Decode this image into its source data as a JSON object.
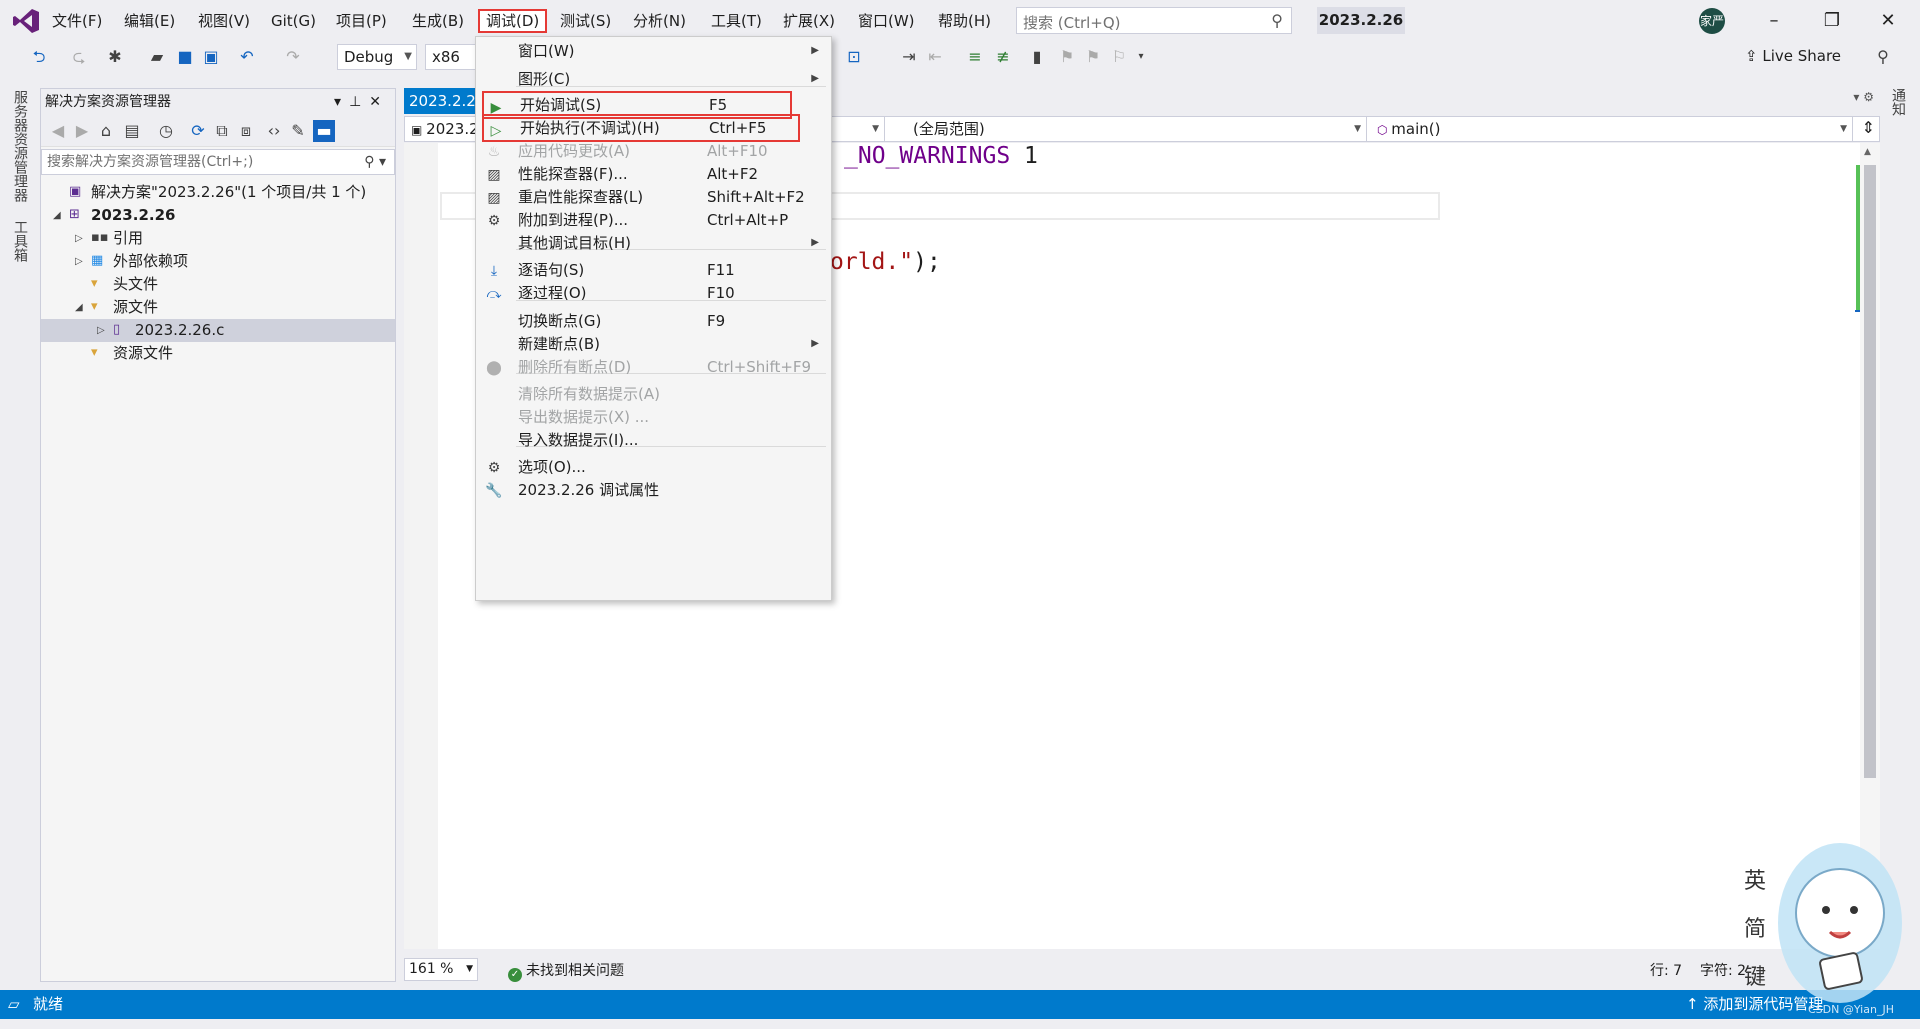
{
  "menubar": {
    "items": [
      "文件(F)",
      "编辑(E)",
      "视图(V)",
      "Git(G)",
      "项目(P)",
      "生成(B)",
      "调试(D)",
      "测试(S)",
      "分析(N)",
      "工具(T)",
      "扩展(X)",
      "窗口(W)",
      "帮助(H)"
    ],
    "active": "调试(D)"
  },
  "search": {
    "placeholder": "搜索 (Ctrl+Q)"
  },
  "solution_name": "2023.2.26",
  "account_initials": "家严",
  "window_controls": {
    "minimize": "–",
    "restore": "❐",
    "close": "✕"
  },
  "toolbar": {
    "config": "Debug",
    "platform": "x86",
    "live_share": "Live Share"
  },
  "left_tabs": [
    "服务器资源管理器",
    "工具箱"
  ],
  "right_tabs": [
    "通知"
  ],
  "solution_explorer": {
    "title": "解决方案资源管理器",
    "search_placeholder": "搜索解决方案资源管理器(Ctrl+;)",
    "tree": [
      {
        "label": "解决方案\"2023.2.26\"(1 个项目/共 1 个)",
        "level": 0,
        "expander": "",
        "icon": "solution-icon",
        "bold": false
      },
      {
        "label": "2023.2.26",
        "level": 0,
        "expander": "◢",
        "icon": "project-icon",
        "bold": true
      },
      {
        "label": "引用",
        "level": 1,
        "expander": "▷",
        "icon": "references-icon",
        "bold": false
      },
      {
        "label": "外部依赖项",
        "level": 1,
        "expander": "▷",
        "icon": "external-deps-icon",
        "bold": false
      },
      {
        "label": "头文件",
        "level": 1,
        "expander": "",
        "icon": "filter-icon",
        "bold": false
      },
      {
        "label": "源文件",
        "level": 1,
        "expander": "◢",
        "icon": "filter-icon",
        "bold": false
      },
      {
        "label": "2023.2.26.c",
        "level": 2,
        "expander": "▷",
        "icon": "c-file-icon",
        "bold": false
      },
      {
        "label": "资源文件",
        "level": 1,
        "expander": "",
        "icon": "filter-icon",
        "bold": false
      }
    ],
    "selected": "2023.2.26.c"
  },
  "editor": {
    "tab_label": "2023.2.26",
    "nav_file": "2023.2",
    "nav_scope": "(全局范围)",
    "nav_member": "main()",
    "code_visible": [
      {
        "text": "_NO_WARNINGS",
        "color": "#6f008a"
      },
      {
        "text": " 1",
        "color": "#1e1e1e"
      },
      {
        "text": "orld.\"",
        "color": "#a31515"
      },
      {
        "text": ");",
        "color": "#1e1e1e"
      }
    ],
    "zoom": "161 %",
    "issues": "未找到相关问题",
    "line": "行: 7",
    "col": "字符: 2"
  },
  "debug_menu": {
    "items": [
      {
        "label": "窗口(W)",
        "shortcut": "",
        "icon": "",
        "submenu": true,
        "disabled": false,
        "highlighted": false
      },
      {
        "label": "图形(C)",
        "shortcut": "",
        "icon": "",
        "submenu": true,
        "disabled": false,
        "highlighted": false
      },
      {
        "label": "开始调试(S)",
        "shortcut": "F5",
        "icon": "play-icon",
        "submenu": false,
        "disabled": false,
        "highlighted": true
      },
      {
        "label": "开始执行(不调试)(H)",
        "shortcut": "Ctrl+F5",
        "icon": "play-outline-icon",
        "submenu": false,
        "disabled": false,
        "highlighted": true
      },
      {
        "label": "应用代码更改(A)",
        "shortcut": "Alt+F10",
        "icon": "flame-icon",
        "submenu": false,
        "disabled": true,
        "highlighted": false
      },
      {
        "label": "性能探查器(F)...",
        "shortcut": "Alt+F2",
        "icon": "profiler-icon",
        "submenu": false,
        "disabled": false,
        "highlighted": false
      },
      {
        "label": "重启性能探查器(L)",
        "shortcut": "Shift+Alt+F2",
        "icon": "profiler-restart-icon",
        "submenu": false,
        "disabled": false,
        "highlighted": false
      },
      {
        "label": "附加到进程(P)...",
        "shortcut": "Ctrl+Alt+P",
        "icon": "attach-icon",
        "submenu": false,
        "disabled": false,
        "highlighted": false
      },
      {
        "label": "其他调试目标(H)",
        "shortcut": "",
        "icon": "",
        "submenu": true,
        "disabled": false,
        "highlighted": false
      },
      {
        "label": "逐语句(S)",
        "shortcut": "F11",
        "icon": "step-into-icon",
        "submenu": false,
        "disabled": false,
        "highlighted": false
      },
      {
        "label": "逐过程(O)",
        "shortcut": "F10",
        "icon": "step-over-icon",
        "submenu": false,
        "disabled": false,
        "highlighted": false
      },
      {
        "label": "切换断点(G)",
        "shortcut": "F9",
        "icon": "",
        "submenu": false,
        "disabled": false,
        "highlighted": false
      },
      {
        "label": "新建断点(B)",
        "shortcut": "",
        "icon": "",
        "submenu": true,
        "disabled": false,
        "highlighted": false
      },
      {
        "label": "删除所有断点(D)",
        "shortcut": "Ctrl+Shift+F9",
        "icon": "delete-breakpoints-icon",
        "submenu": false,
        "disabled": true,
        "highlighted": false
      },
      {
        "label": "清除所有数据提示(A)",
        "shortcut": "",
        "icon": "",
        "submenu": false,
        "disabled": true,
        "highlighted": false
      },
      {
        "label": "导出数据提示(X) ...",
        "shortcut": "",
        "icon": "",
        "submenu": false,
        "disabled": true,
        "highlighted": false
      },
      {
        "label": "导入数据提示(I)...",
        "shortcut": "",
        "icon": "",
        "submenu": false,
        "disabled": false,
        "highlighted": false
      },
      {
        "label": "选项(O)...",
        "shortcut": "",
        "icon": "gear-icon",
        "submenu": false,
        "disabled": false,
        "highlighted": false
      },
      {
        "label": "2023.2.26 调试属性",
        "shortcut": "",
        "icon": "wrench-icon",
        "submenu": false,
        "disabled": false,
        "highlighted": false
      }
    ]
  },
  "statusbar": {
    "ready": "就绪",
    "add_source": "添加到源代码管理"
  },
  "watermark": "CSDN @Yian_JH",
  "colors": {
    "accent": "#007acc",
    "highlight_border": "#e53935",
    "play_green": "#388e3c"
  }
}
